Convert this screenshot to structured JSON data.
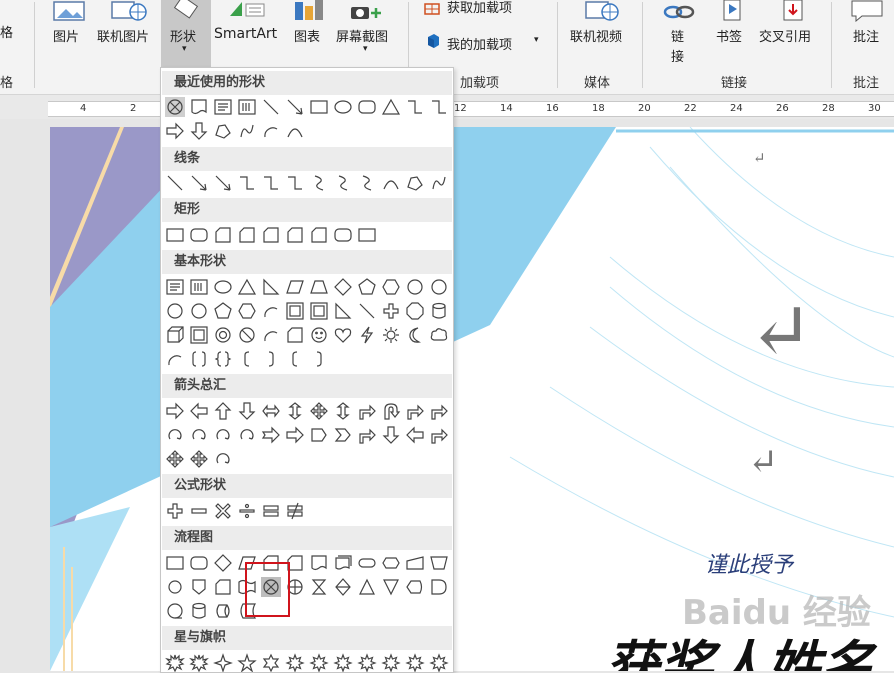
{
  "ribbon": {
    "partial_left_top": "格",
    "partial_left_bottom": "格",
    "picture_label": "图片",
    "online_picture_label": "联机图片",
    "shapes_label": "形状",
    "smartart_label": "SmartArt",
    "chart_label": "图表",
    "screenshot_label": "屏幕截图",
    "get_addins_label": "获取加载项",
    "my_addins_label": "我的加载项",
    "addins_group": "加载项",
    "online_video_label": "联机视频",
    "media_group": "媒体",
    "link_label_1": "链",
    "link_label_2": "接",
    "bookmark_label": "书签",
    "cross_ref_label": "交叉引用",
    "links_group": "链接",
    "comment_label": "批注",
    "comments_group": "批注"
  },
  "ruler": {
    "ticks": [
      "4",
      "2",
      "12",
      "14",
      "16",
      "18",
      "20",
      "22",
      "24",
      "26",
      "28",
      "30"
    ]
  },
  "shapes_menu": {
    "sections": {
      "recent": "最近使用的形状",
      "lines": "线条",
      "rectangles": "矩形",
      "basic": "基本形状",
      "arrows": "箭头总汇",
      "equation": "公式形状",
      "flowchart": "流程图",
      "stars": "星与旗帜"
    }
  },
  "document": {
    "caption": "谨此授予",
    "headline": "获奖人姓名",
    "return_mark": "↵"
  },
  "watermark": "Baidu 经验",
  "colors": {
    "accent_red": "#d0141c",
    "doc_blue": "#8fd0ee",
    "doc_purple": "#9a98c8",
    "doc_cream": "#f7dba8"
  }
}
